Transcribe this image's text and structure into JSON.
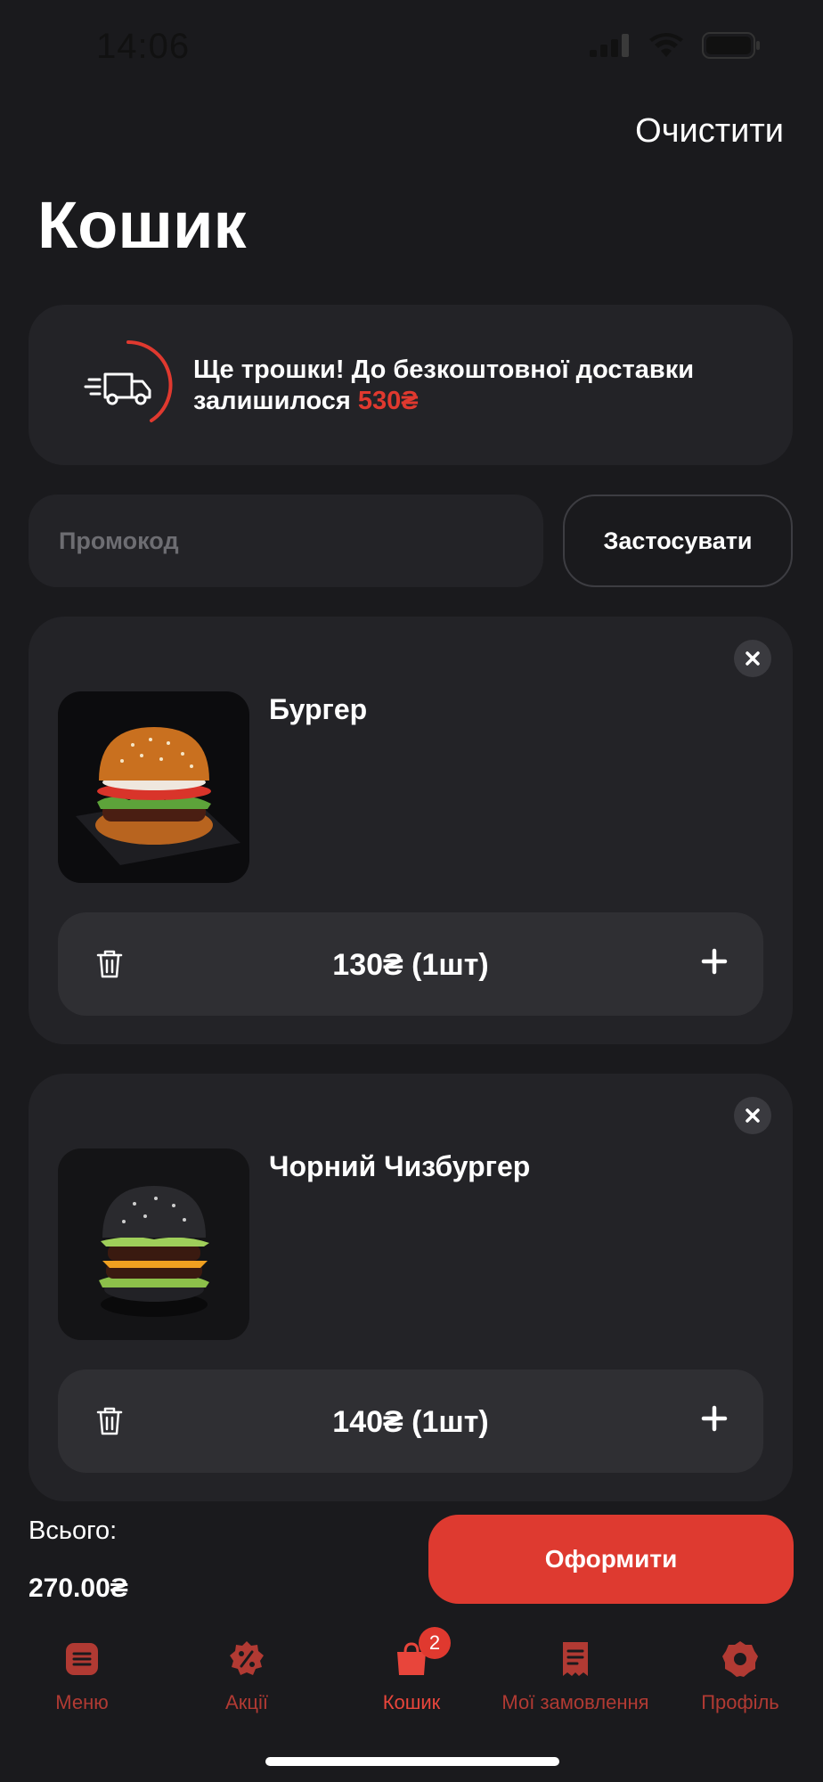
{
  "status_bar": {
    "time": "14:06"
  },
  "header": {
    "clear_label": "Очистити",
    "title": "Кошик"
  },
  "delivery": {
    "message": "Ще трошки! До безкоштовної доставки залишилося",
    "amount": "530₴"
  },
  "promo": {
    "placeholder": "Промокод",
    "apply_label": "Застосувати"
  },
  "cart": {
    "items": [
      {
        "name": "Бургер",
        "quantity_label": "130₴ (1шт)"
      },
      {
        "name": "Чорний Чизбургер",
        "quantity_label": "140₴ (1шт)"
      }
    ]
  },
  "summary": {
    "total_label": "Всього:",
    "total_value": "270.00₴",
    "checkout_label": "Оформити"
  },
  "tabs": [
    {
      "label": "Меню",
      "icon": "menu-icon"
    },
    {
      "label": "Акції",
      "icon": "discount-icon"
    },
    {
      "label": "Кошик",
      "icon": "cart-icon",
      "badge": "2",
      "active": true
    },
    {
      "label": "Мої замовлення",
      "icon": "receipt-icon"
    },
    {
      "label": "Профіль",
      "icon": "profile-icon"
    }
  ],
  "colors": {
    "accent": "#de3a30",
    "background": "#1a1a1d",
    "card": "#232327"
  }
}
